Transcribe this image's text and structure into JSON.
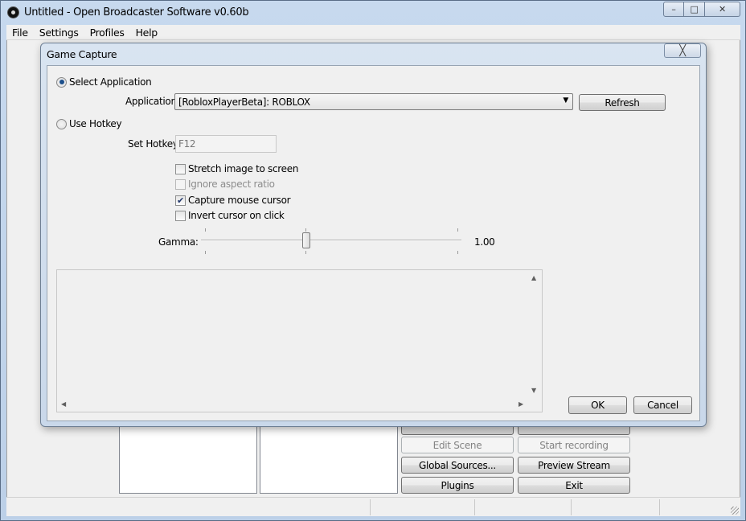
{
  "window": {
    "title": "Untitled - Open Broadcaster Software v0.60b",
    "min_glyph": "–",
    "max_glyph": "□",
    "close_glyph": "✕"
  },
  "menu": [
    "File",
    "Settings",
    "Profiles",
    "Help"
  ],
  "main_buttons": {
    "edit_scene": "Edit Scene",
    "start_recording": "Start recording",
    "global_sources": "Global Sources...",
    "preview_stream": "Preview Stream",
    "plugins": "Plugins",
    "exit": "Exit"
  },
  "dialog": {
    "title": "Game Capture",
    "close_glyph": "╳",
    "select_application_label": "Select Application",
    "application_label": "Application:",
    "application_value": "[RobloxPlayerBeta]: ROBLOX",
    "dropdown_glyph": "▼",
    "refresh_label": "Refresh",
    "use_hotkey_label": "Use Hotkey",
    "set_hotkey_label": "Set Hotkey",
    "hotkey_value": "F12",
    "options": [
      {
        "label": "Stretch image to screen",
        "checked": false,
        "enabled": true
      },
      {
        "label": "Ignore aspect ratio",
        "checked": false,
        "enabled": false
      },
      {
        "label": "Capture mouse cursor",
        "checked": true,
        "enabled": true
      },
      {
        "label": "Invert cursor on click",
        "checked": false,
        "enabled": true
      }
    ],
    "check_glyph": "✔",
    "gamma_label": "Gamma:",
    "gamma_value": "1.00",
    "gamma_level": 0.5,
    "ok_label": "OK",
    "cancel_label": "Cancel",
    "scroll_up_glyph": "▲",
    "scroll_down_glyph": "▼",
    "scroll_left_glyph": "◀",
    "scroll_right_glyph": "▶"
  }
}
